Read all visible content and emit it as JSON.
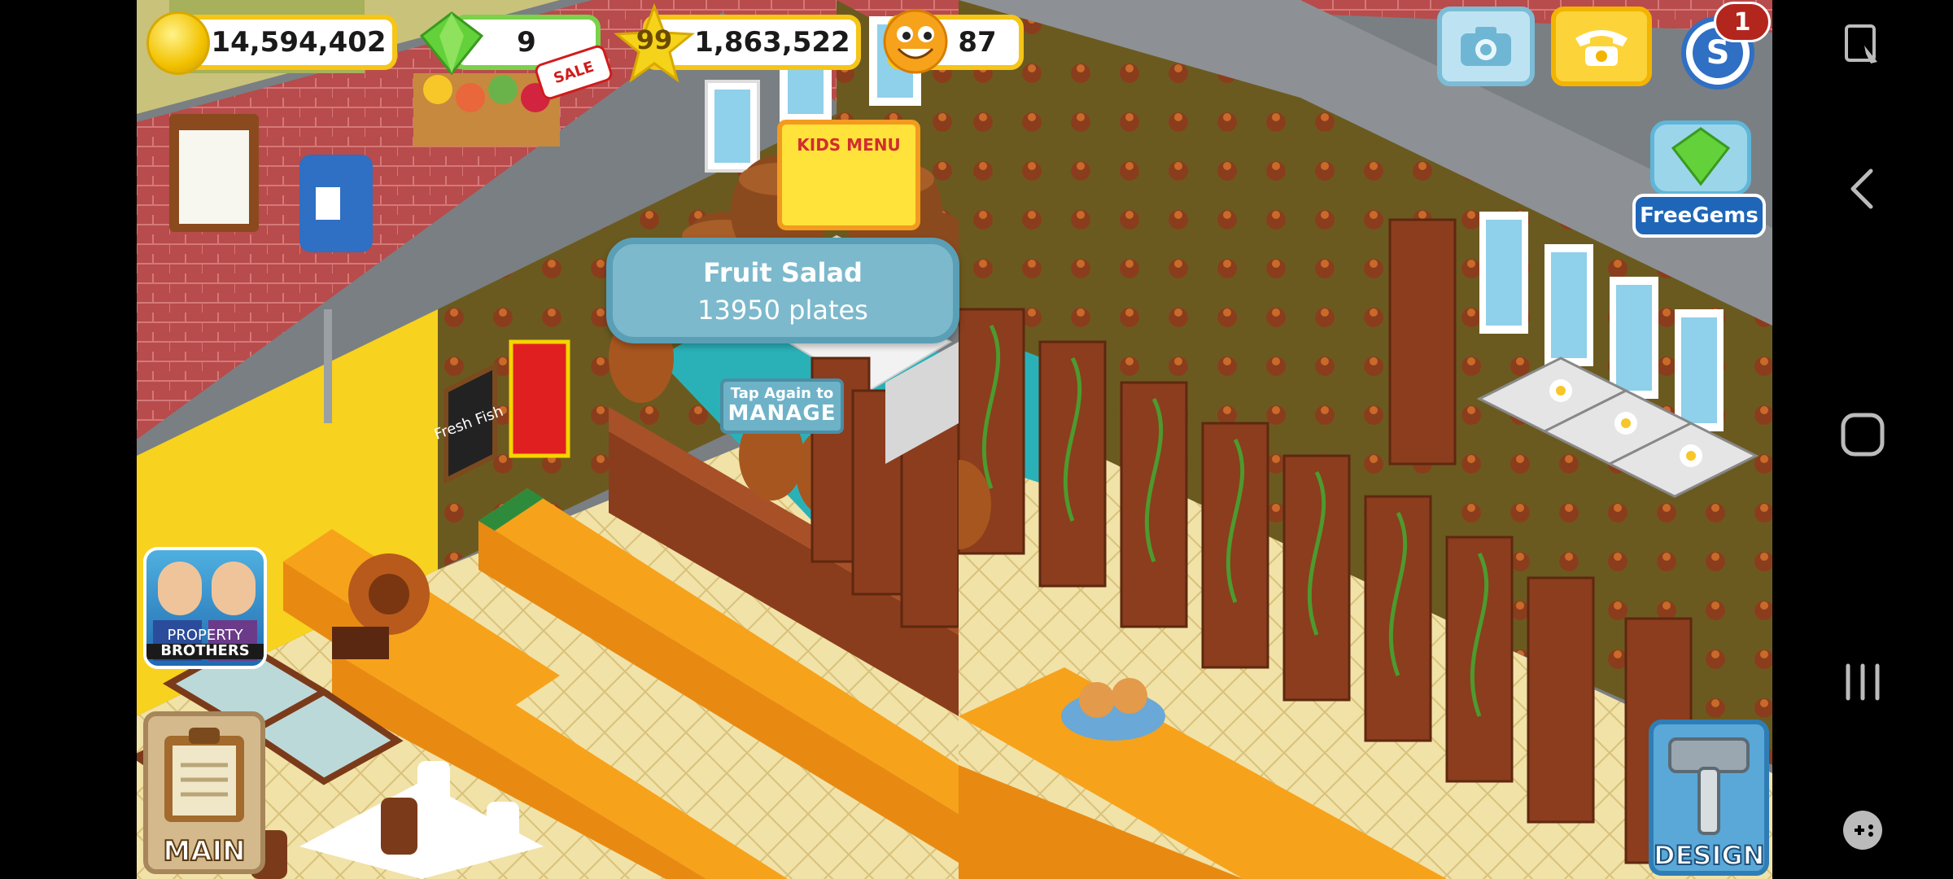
{
  "hud": {
    "coins": "14,594,402",
    "gems": "9",
    "sale_badge": "SALE",
    "level": "99",
    "experience": "1,863,522",
    "happiness": "87"
  },
  "buttons": {
    "notification_count": "1",
    "free_gems_label": "FreeGems",
    "property_brothers_line1": "PROPERTY",
    "property_brothers_line2": "BROTHERS",
    "main_label": "MAIN",
    "design_label": "DESIGN"
  },
  "tooltip": {
    "dish": "Fruit Salad",
    "plates": "13950 plates"
  },
  "manage_hint": {
    "line1": "Tap Again to",
    "line2": "MANAGE"
  },
  "signs": {
    "fresh_fish": "Fresh Fish",
    "kids_menu": "KIDS MENU"
  },
  "colors": {
    "hud_border": "#f5c518",
    "tooltip_bg": "#7cb9cc",
    "table_orange": "#f7a21b",
    "carpet_teal": "#2ab1b8",
    "wall_pattern": "#6b5a1f"
  },
  "system_nav": {
    "icons": [
      "screenshot-icon",
      "back-icon",
      "home-icon",
      "recents-icon",
      "game-tools-icon"
    ]
  }
}
